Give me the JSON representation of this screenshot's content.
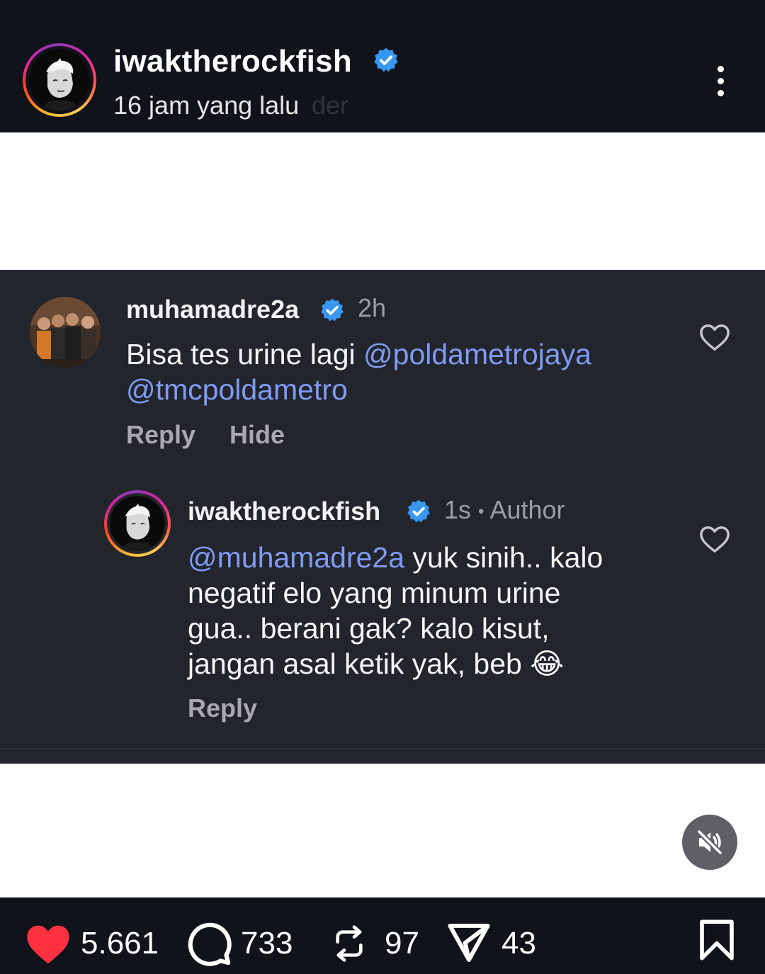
{
  "header": {
    "username": "iwaktherockfish",
    "time": "16 jam yang lalu",
    "time_ghost": "der"
  },
  "comments": [
    {
      "username": "muhamadre2a",
      "time": "2h",
      "text_plain": "Bisa tes urine lagi ",
      "mention_1": "@poldametrojaya",
      "mention_2": "@tmcpoldametro",
      "reply_label": "Reply",
      "hide_label": "Hide"
    },
    {
      "username": "iwaktherockfish",
      "time": "1s",
      "separator": "•",
      "author_label": "Author",
      "mention": "@muhamadre2a",
      "line1": " yuk sinih.. kalo",
      "line2": "negatif elo yang minum urine",
      "line3": "gua.. berani gak? kalo kisut,",
      "line4": "jangan asal ketik yak, beb",
      "emoji": "😂",
      "reply_label": "Reply"
    }
  ],
  "stats": {
    "likes": "5.661",
    "comments": "733",
    "reposts": "97",
    "shares": "43"
  },
  "colors": {
    "header_bg": "#10131a",
    "card_bg": "#23252d",
    "mention": "#7f9bf3",
    "verified": "#3897f0",
    "like": "#ff3040"
  },
  "icons": [
    "verified-badge-icon",
    "more-options-icon",
    "heart-outline-icon",
    "mute-icon",
    "heart-filled-icon",
    "comment-icon",
    "repost-icon",
    "send-icon",
    "bookmark-icon"
  ]
}
